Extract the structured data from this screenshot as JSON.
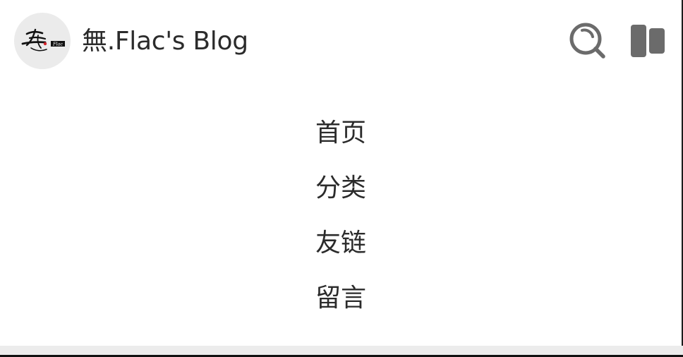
{
  "header": {
    "avatar_alt": "無 Flac",
    "avatar_text": "Flac",
    "site_title": "無.Flac's Blog",
    "icons": {
      "search": "search-icon",
      "menu": "menu-icon"
    }
  },
  "nav": {
    "items": [
      {
        "label": "首页"
      },
      {
        "label": "分类"
      },
      {
        "label": "友链"
      },
      {
        "label": "留言"
      }
    ]
  },
  "colors": {
    "background": "#ffffff",
    "text": "#2b2b2b",
    "icon": "#6b6b6b",
    "avatar_bg": "#ebebeb"
  }
}
